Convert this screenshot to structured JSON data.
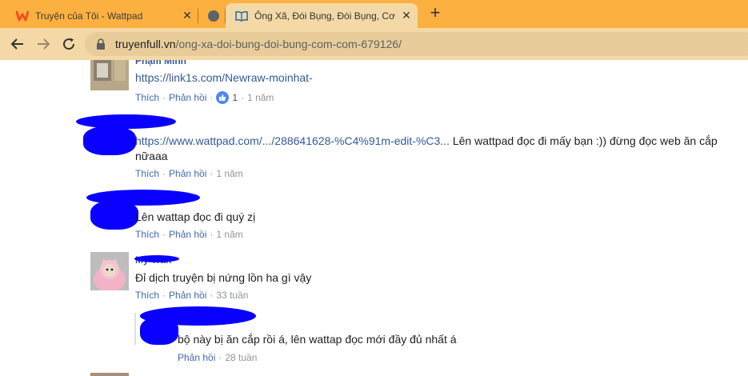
{
  "tabs": [
    {
      "title": "Truyện của Tôi - Wattpad"
    },
    {
      "title": ""
    },
    {
      "title": "Ông Xã, Đói Bụng, Đói Bụng, Cơm Cơm"
    }
  ],
  "toolbar": {
    "url_domain": "truyenfull.vn",
    "url_path": "/ong-xa-doi-bung-doi-bung-com-com-679126/"
  },
  "comments": [
    {
      "author": "Phạm Minh",
      "link": "https://link1s.com/Newraw-moinhat-",
      "text": "",
      "like": "Thích",
      "reply": "Phản hồi",
      "reactions": "1",
      "time": "1 năm"
    },
    {
      "author": "",
      "link": "https://www.wattpad.com/.../288641628-%C4%91m-edit-%C3...",
      "text": " Lên wattpad đọc đi mấy bạn :)) đừng đọc web ăn cắp",
      "text_line2": "nữaaa",
      "like": "Thích",
      "reply": "Phản hồi",
      "time": "1 năm"
    },
    {
      "author": "",
      "text": "Lên wattap đọc đi quý zị",
      "like": "Thích",
      "reply": "Phản hồi",
      "time": "1 năm"
    },
    {
      "author": "Mỹ Trần",
      "text": "Đỉ dịch truyện bị nứng lồn ha gì vậy",
      "like": "Thích",
      "reply": "Phản hồi",
      "time": "33 tuần"
    }
  ],
  "reply": {
    "text": "bộ này bị ăn cắp rồi á, lên wattap đọc mới đầy đủ nhất á",
    "reply": "Phản hồi",
    "time": "28 tuần"
  },
  "colors": {
    "tabstrip": "#fbb040",
    "toolbar": "#f4d9a6",
    "redaction": "#0a00ff",
    "link": "#365899"
  }
}
